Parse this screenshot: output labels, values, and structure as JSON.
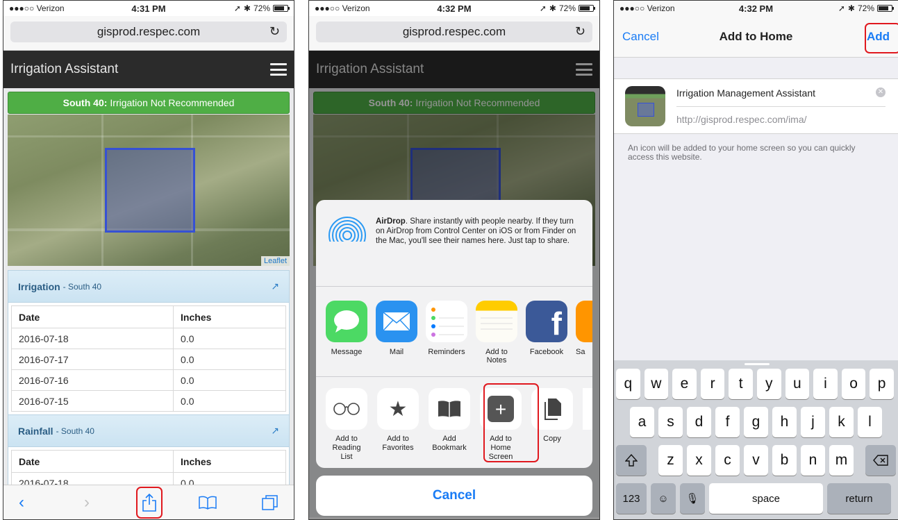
{
  "status": {
    "carrier": "●●●○○ Verizon",
    "time1": "4:31 PM",
    "time2": "4:32 PM",
    "time3": "4:32 PM",
    "battery": "72%"
  },
  "browser": {
    "url": "gisprod.respec.com"
  },
  "app": {
    "title": "Irrigation Assistant",
    "alert_field": "South 40:",
    "alert_text": "Irrigation Not Recommended",
    "map_attribution": "Leaflet"
  },
  "irrigation": {
    "title": "Irrigation",
    "subtitle": "- South 40",
    "headers": [
      "Date",
      "Inches"
    ],
    "rows": [
      [
        "2016-07-18",
        "0.0"
      ],
      [
        "2016-07-17",
        "0.0"
      ],
      [
        "2016-07-16",
        "0.0"
      ],
      [
        "2016-07-15",
        "0.0"
      ]
    ]
  },
  "rainfall": {
    "title": "Rainfall",
    "subtitle": "- South 40",
    "headers": [
      "Date",
      "Inches"
    ],
    "rows": [
      [
        "2016-07-18",
        "0.0"
      ]
    ]
  },
  "share_sheet": {
    "airdrop_title": "AirDrop",
    "airdrop_text": ". Share instantly with people nearby. If they turn on AirDrop from Control Center on iOS or from Finder on the Mac, you'll see their names here. Just tap to share.",
    "apps": [
      "Message",
      "Mail",
      "Reminders",
      "Add to Notes",
      "Facebook",
      "Sa"
    ],
    "actions": [
      [
        "Add to",
        "Reading List"
      ],
      [
        "Add to",
        "Favorites"
      ],
      [
        "Add",
        "Bookmark"
      ],
      [
        "Add to",
        "Home Screen"
      ],
      [
        "Copy",
        ""
      ]
    ],
    "cancel": "Cancel"
  },
  "add_home": {
    "cancel": "Cancel",
    "title": "Add to Home",
    "add": "Add",
    "name_value": "Irrigation Management Assistant",
    "url": "http://gisprod.respec.com/ima/",
    "hint": "An icon will be added to your home screen so you can quickly access this website."
  },
  "keyboard": {
    "row1": [
      "q",
      "w",
      "e",
      "r",
      "t",
      "y",
      "u",
      "i",
      "o",
      "p"
    ],
    "row2": [
      "a",
      "s",
      "d",
      "f",
      "g",
      "h",
      "j",
      "k",
      "l"
    ],
    "row3": [
      "z",
      "x",
      "c",
      "v",
      "b",
      "n",
      "m"
    ],
    "numbers_key": "123",
    "space_key": "space",
    "return_key": "return"
  },
  "icons": {
    "back": "chevron-left-icon",
    "forward": "chevron-right-icon",
    "share": "share-icon",
    "bookmarks": "book-icon",
    "tabs": "tabs-icon",
    "reload": "reload-icon"
  },
  "colors": {
    "ios_blue": "#1a7cf5",
    "alert_green": "#4fae45",
    "highlight_red": "#e0181e",
    "field_outline": "#3651d4"
  }
}
